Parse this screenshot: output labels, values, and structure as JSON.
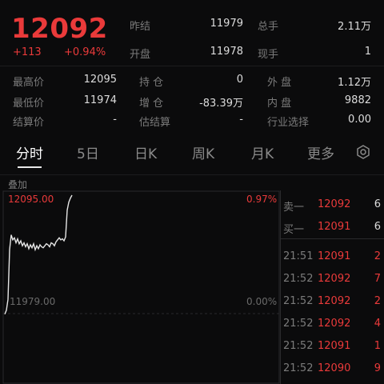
{
  "quote": {
    "last_price": "12092",
    "change": "+113",
    "change_pct": "+0.94%"
  },
  "stats": [
    {
      "label": "昨结",
      "value": "11979"
    },
    {
      "label": "总手",
      "value": "2.11万"
    },
    {
      "label": "开盘",
      "value": "11978"
    },
    {
      "label": "现手",
      "value": "1"
    },
    {
      "label": "最高价",
      "value": "12095"
    },
    {
      "label": "持 仓",
      "value": "0"
    },
    {
      "label": "外 盘",
      "value": "1.12万"
    },
    {
      "label": "最低价",
      "value": "11974"
    },
    {
      "label": "增 仓",
      "value": "-83.39万"
    },
    {
      "label": "内 盘",
      "value": "9882"
    },
    {
      "label": "结算价",
      "value": "-"
    },
    {
      "label": "估结算",
      "value": "-"
    },
    {
      "label": "行业选择",
      "value": "0.00"
    }
  ],
  "tabs": [
    "分时",
    "5日",
    "日K",
    "周K",
    "月K",
    "更多"
  ],
  "chart": {
    "overlay_label": "叠加",
    "high_label": "12095.00",
    "high_pct": "0.97%",
    "base_label": "11979.00",
    "base_pct": "0.00%",
    "line_color": "#e6e6e6"
  },
  "chart_data": {
    "type": "line",
    "title": "",
    "ylim": [
      11974,
      12095
    ],
    "values": [
      11975,
      11979,
      11990,
      12040,
      12055,
      12050,
      12052,
      12047,
      12051,
      12046,
      12049,
      12044,
      12047,
      12043,
      12046,
      12041,
      12045,
      12042,
      12046,
      12040,
      12044,
      12041,
      12045,
      12043,
      12042,
      12044,
      12046,
      12045,
      12043,
      12047,
      12046,
      12044,
      12048,
      12050,
      12052,
      12050,
      12051,
      12049,
      12053,
      12080,
      12088,
      12092,
      12095
    ]
  },
  "orderbook": {
    "quotes": [
      {
        "label": "卖一",
        "price": "12092",
        "qty": "6"
      },
      {
        "label": "买一",
        "price": "12091",
        "qty": "6"
      }
    ],
    "ticks": [
      {
        "time": "21:51",
        "price": "12091",
        "qty": "2"
      },
      {
        "time": "21:52",
        "price": "12092",
        "qty": "7"
      },
      {
        "time": "21:52",
        "price": "12092",
        "qty": "2"
      },
      {
        "time": "21:52",
        "price": "12092",
        "qty": "4"
      },
      {
        "time": "21:52",
        "price": "12091",
        "qty": "1"
      },
      {
        "time": "21:52",
        "price": "12090",
        "qty": "9"
      }
    ]
  },
  "colors": {
    "up": "#ea3a3a",
    "background": "#0b0b0c"
  }
}
